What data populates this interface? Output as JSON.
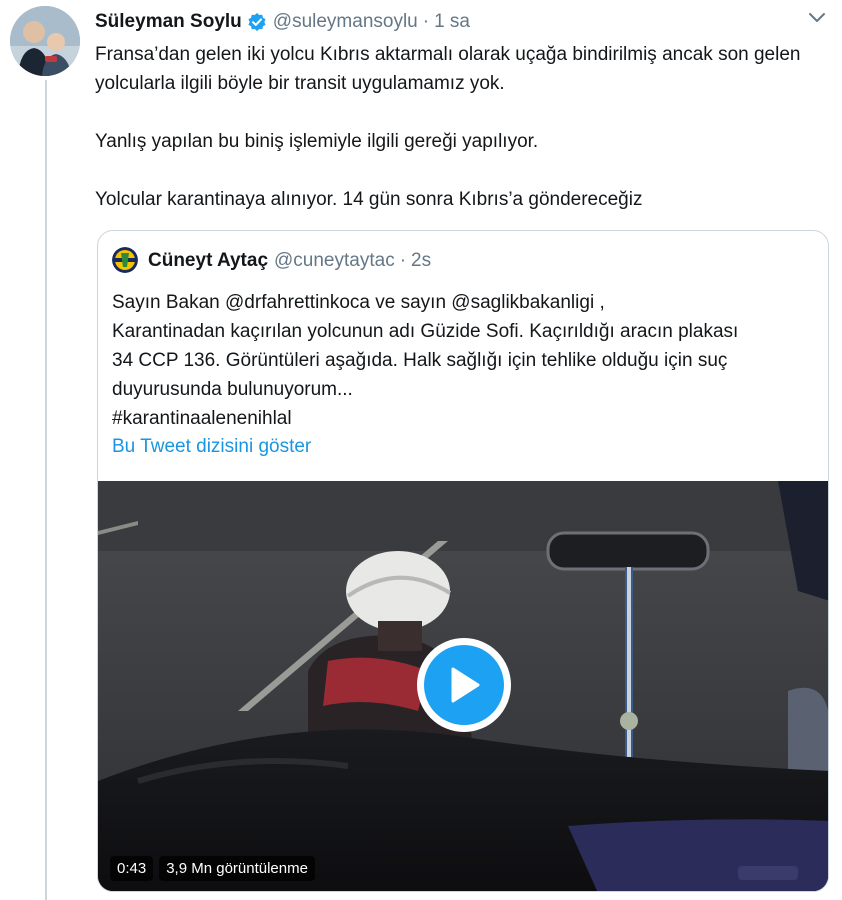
{
  "tweet": {
    "display_name": "Süleyman Soylu",
    "handle": "@suleymansoylu",
    "separator": "·",
    "time": "1 sa",
    "paragraphs": [
      "Fransa’dan gelen iki yolcu Kıbrıs aktarmalı olarak uçağa bindirilmiş ancak son gelen yolcularla ilgili böyle bir transit uygulamamız yok.",
      "Yanlış yapılan bu biniş işlemiyle ilgili gereği yapılıyor.",
      "Yolcular karantinaya alınıyor. 14 gün sonra Kıbrıs’a göndereceğiz"
    ],
    "icons": {
      "verified": "verified-badge-icon",
      "caret": "chevron-down-icon"
    }
  },
  "quote": {
    "display_name": "Cüneyt Aytaç",
    "handle": "@cuneytaytac",
    "separator": "·",
    "time": "2s",
    "lines": [
      "Sayın Bakan @drfahrettinkoca ve sayın @saglikbakanligi ,",
      "Karantinadan kaçırılan yolcunun adı Güzide Sofi. Kaçırıldığı aracın plakası",
      "34 CCP 136. Görüntüleri aşağıda. Halk sağlığı için tehlike olduğu için suç",
      "duyurusunda bulunuyorum...",
      "#karantinaalenenihlal"
    ],
    "show_thread": "Bu Tweet dizisini göster",
    "video": {
      "duration": "0:43",
      "views": "3,9 Mn görüntülenme",
      "play_icon": "play-icon"
    }
  },
  "colors": {
    "link": "#1b95e0",
    "secondary": "#657786",
    "play": "#1da1f2",
    "verified": "#1da1f2"
  }
}
